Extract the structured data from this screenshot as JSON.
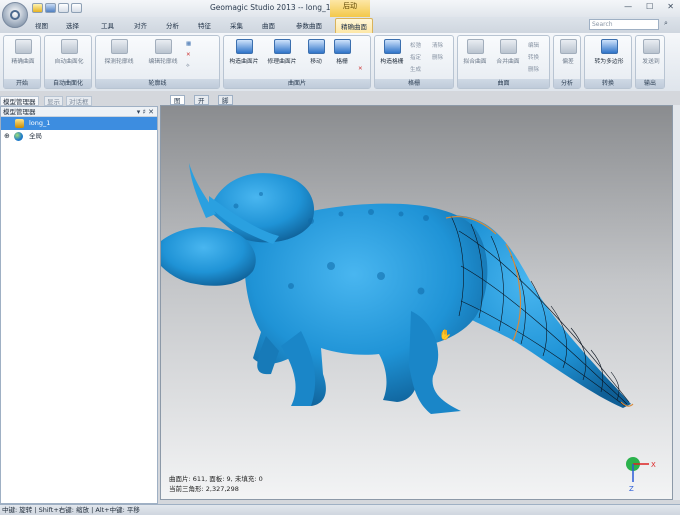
{
  "window": {
    "title": "Geomagic Studio 2013 -- long_1.stl",
    "context_title": "后动",
    "controls": [
      "—",
      "☐",
      "✕"
    ]
  },
  "tabs": [
    "视图",
    "选择",
    "工具",
    "对齐",
    "分析",
    "特征",
    "采集",
    "曲面",
    "参数曲面",
    "精确曲面"
  ],
  "active_tab": "精确曲面",
  "search": {
    "placeholder": "Search"
  },
  "ribbon": {
    "groups": [
      {
        "label": "开始",
        "buttons": [
          "精确曲面"
        ]
      },
      {
        "label": "自动曲面化",
        "buttons": [
          "自动曲面化"
        ]
      },
      {
        "label": "轮廓线",
        "buttons": [
          "探测轮廓线",
          "编辑轮廓线"
        ]
      },
      {
        "label": "曲面片",
        "buttons": [
          "构造曲面片",
          "修理曲面片",
          "移动",
          "格栅"
        ]
      },
      {
        "label": "格栅",
        "buttons": [
          "构造格栅",
          "松弛",
          "指定",
          "生成",
          "清除",
          "删除"
        ]
      },
      {
        "label": "曲面",
        "buttons": [
          "拟合曲面",
          "合并曲面",
          "编辑",
          "转换",
          "删除"
        ]
      },
      {
        "label": "分析",
        "buttons": [
          "偏差"
        ]
      },
      {
        "label": "转换",
        "buttons": [
          "转为多边形"
        ]
      },
      {
        "label": "输出",
        "buttons": [
          "发送到"
        ]
      }
    ]
  },
  "left_panel": {
    "tabs": [
      "模型管理器",
      "显示",
      "对话框"
    ],
    "header": "模型管理器",
    "header_controls": [
      "▾",
      "♯",
      "✕"
    ],
    "items": [
      {
        "label": "long_1",
        "selected": true
      },
      {
        "label": "全局",
        "expander": "⊕"
      }
    ]
  },
  "viewport": {
    "tabs": [
      "图形",
      "开始",
      "脚本"
    ],
    "stats_line1": "曲面片: 611, 面板: 9, 未填充: 0",
    "stats_line2": "当前三角形: 2,327,298",
    "axis": {
      "x": "X",
      "z": "Z"
    }
  },
  "statusbar": {
    "text": "中键: 旋转 | Shift+右键: 缩放 | Alt+中键: 平移"
  },
  "colors": {
    "model": "#1f93d6",
    "accent": "#fde7a6",
    "selection": "#3d8de0",
    "patch_lines": "#d98a3a"
  }
}
